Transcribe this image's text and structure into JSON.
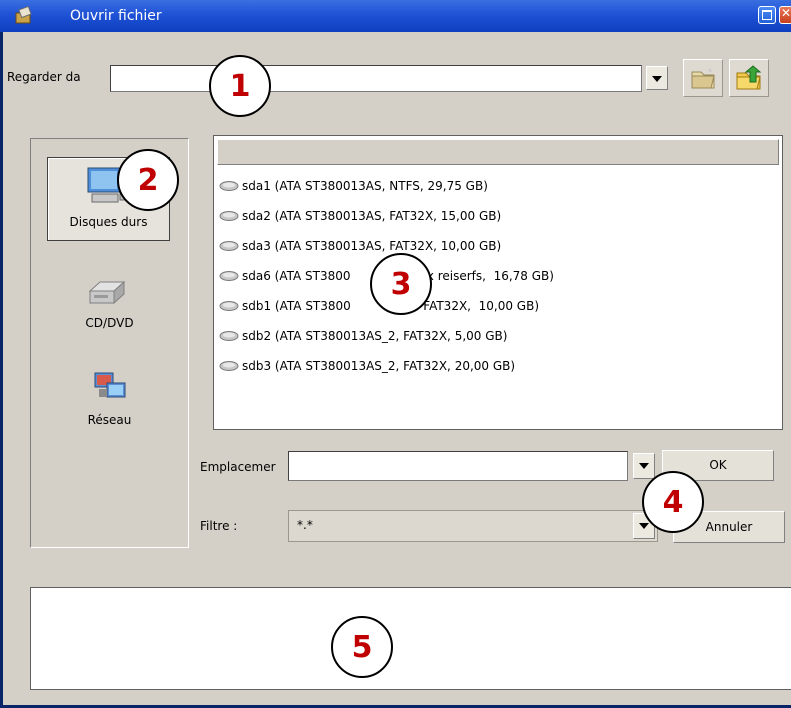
{
  "window": {
    "title": "Ouvrir fichier"
  },
  "look_in": {
    "label": "Regarder da",
    "value": ""
  },
  "sidebar": {
    "items": [
      {
        "label": "Disques durs",
        "icon": "hard-drive-icon",
        "active": true
      },
      {
        "label": "CD/DVD",
        "icon": "cd-dvd-drive-icon",
        "active": false
      },
      {
        "label": "Réseau",
        "icon": "network-icon",
        "active": false
      }
    ]
  },
  "files": [
    {
      "name": "sda1 (ATA ST380013AS,  NTFS,  29,75 GB)",
      "icon": "disk-icon"
    },
    {
      "name": "sda2 (ATA ST380013AS,  FAT32X,  15,00 GB)",
      "icon": "disk-icon"
    },
    {
      "name": "sda3 (ATA ST380013AS,  FAT32X,  10,00 GB)",
      "icon": "disk-icon"
    },
    {
      "name": "sda6 (ATA ST3800                nux reiserfs,  16,78 GB)",
      "icon": "disk-icon"
    },
    {
      "name": "sdb1 (ATA ST3800                ,  FAT32X,  10,00 GB)",
      "icon": "disk-icon"
    },
    {
      "name": "sdb2 (ATA ST380013AS_2,  FAT32X,  5,00 GB)",
      "icon": "disk-icon"
    },
    {
      "name": "sdb3 (ATA ST380013AS_2,  FAT32X,  20,00 GB)",
      "icon": "disk-icon"
    }
  ],
  "location": {
    "label": "Emplacemer",
    "value": ""
  },
  "filter": {
    "label": "Filtre :",
    "value": "*.*"
  },
  "buttons": {
    "ok": "OK",
    "cancel": "Annuler"
  },
  "callouts": [
    "1",
    "2",
    "3",
    "4",
    "5"
  ],
  "colors": {
    "titlebar": "#1f52d6",
    "callout_text": "#c00000",
    "window_bg": "#d4d0c8"
  }
}
